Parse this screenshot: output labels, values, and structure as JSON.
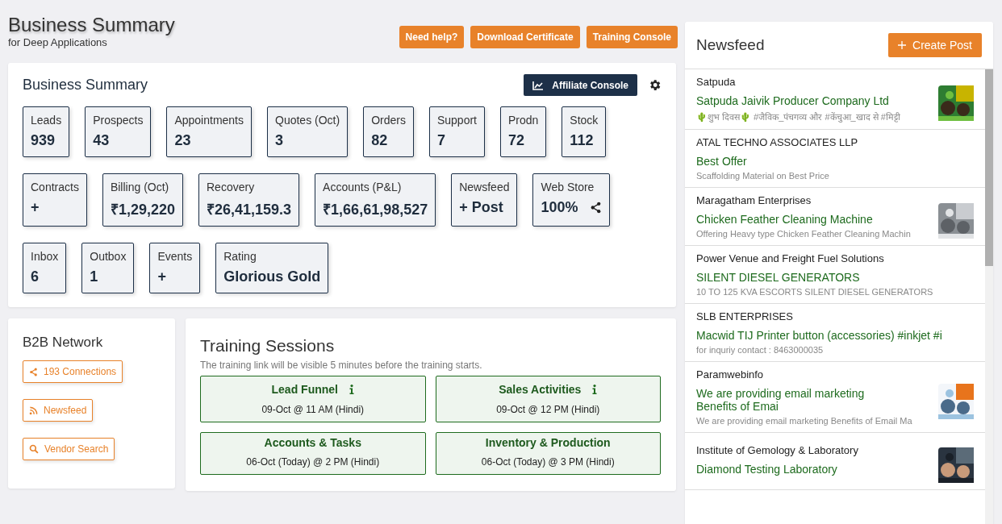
{
  "header": {
    "title": "Business Summary",
    "subtitle": "for Deep Applications",
    "buttons": [
      "Need help?",
      "Download Certificate",
      "Training Console"
    ]
  },
  "summary": {
    "title": "Business Summary",
    "affiliate_button": "Affiliate Console",
    "tiles": [
      {
        "label": "Leads",
        "value": "939"
      },
      {
        "label": "Prospects",
        "value": "43"
      },
      {
        "label": "Appointments",
        "value": "23"
      },
      {
        "label": "Quotes (Oct)",
        "value": "3"
      },
      {
        "label": "Orders",
        "value": "82"
      },
      {
        "label": "Support",
        "value": "7"
      },
      {
        "label": "Prodn",
        "value": "72"
      },
      {
        "label": "Stock",
        "value": "112"
      },
      {
        "label": "Contracts",
        "value": "+"
      },
      {
        "label": "Billing (Oct)",
        "value": "₹1,29,220"
      },
      {
        "label": "Recovery",
        "value": "₹26,41,159.3"
      },
      {
        "label": "Accounts (P&L)",
        "value": "₹1,66,61,98,527"
      },
      {
        "label": "Newsfeed",
        "value": "+ Post"
      },
      {
        "label": "Web Store",
        "value": "100%",
        "share": true
      },
      {
        "label": "Inbox",
        "value": "6"
      },
      {
        "label": "Outbox",
        "value": "1"
      },
      {
        "label": "Events",
        "value": "+"
      },
      {
        "label": "Rating",
        "value": "Glorious Gold"
      }
    ]
  },
  "b2b": {
    "title": "B2B Network",
    "links": [
      {
        "kind": "share",
        "label": "193 Connections"
      },
      {
        "kind": "rss",
        "label": "Newsfeed"
      },
      {
        "kind": "search",
        "label": "Vendor Search"
      }
    ]
  },
  "training": {
    "title": "Training Sessions",
    "note": "The training link will be visible 5 minutes before the training starts.",
    "sessions": [
      {
        "name": "Lead Funnel",
        "info": true,
        "time": "09-Oct @ 11 AM (Hindi)"
      },
      {
        "name": "Sales Activities",
        "info": true,
        "time": "09-Oct @ 12 PM (Hindi)"
      },
      {
        "name": "Accounts & Tasks",
        "info": false,
        "time": "06-Oct (Today) @ 2 PM (Hindi)"
      },
      {
        "name": "Inventory & Production",
        "info": false,
        "time": "06-Oct (Today) @ 3 PM (Hindi)"
      }
    ]
  },
  "newsfeed": {
    "title": "Newsfeed",
    "create_button": "Create Post",
    "items": [
      {
        "company": "Satpuda",
        "title": "Satpuda Jaivik Producer Company Ltd",
        "description": "🌵शुभ दिवस🌵 #जैविक_पंचगव्य और #केंचुआ_खाद से #मिट्टी",
        "picture": true
      },
      {
        "company": "ATAL TECHNO ASSOCIATES LLP",
        "title": "Best Offer",
        "description": "Scaffolding Material on Best Price"
      },
      {
        "company": "Maragatham Enterprises",
        "title": "Chicken Feather Cleaning Machine",
        "description": "Offering Heavy type Chicken Feather Cleaning Machin",
        "picture": true
      },
      {
        "company": "Power Venue and Freight Fuel Solutions",
        "title": "SILENT DIESEL GENERATORS",
        "description": "10 TO 125 KVA ESCORTS SILENT DIESEL GENERATORS"
      },
      {
        "company": "SLB ENTERPRISES",
        "title": "Macwid TIJ Printer button (accessories) #inkjet #i",
        "description": "for inquriy contact : 8463000035"
      },
      {
        "company": "Paramwebinfo",
        "title": "We are providing email marketing Benefits of Emai",
        "description": "We are providing email marketing Benefits of Email Ma",
        "picture": true
      },
      {
        "company": "Institute of Gemology & Laboratory",
        "title": "Diamond Testing Laboratory",
        "picture": true
      }
    ]
  }
}
